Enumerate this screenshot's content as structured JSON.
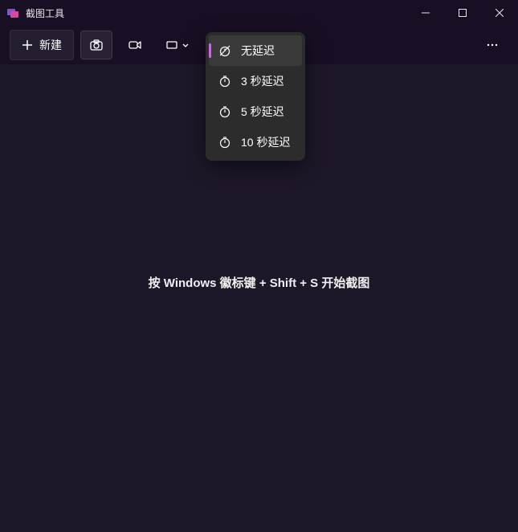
{
  "window": {
    "title": "截图工具"
  },
  "toolbar": {
    "new_label": "新建"
  },
  "delay_menu": {
    "items": [
      {
        "label": "无延迟"
      },
      {
        "label": "3 秒延迟"
      },
      {
        "label": "5 秒延迟"
      },
      {
        "label": "10 秒延迟"
      }
    ]
  },
  "content": {
    "hint": "按 Windows 徽标键 + Shift + S 开始截图"
  }
}
